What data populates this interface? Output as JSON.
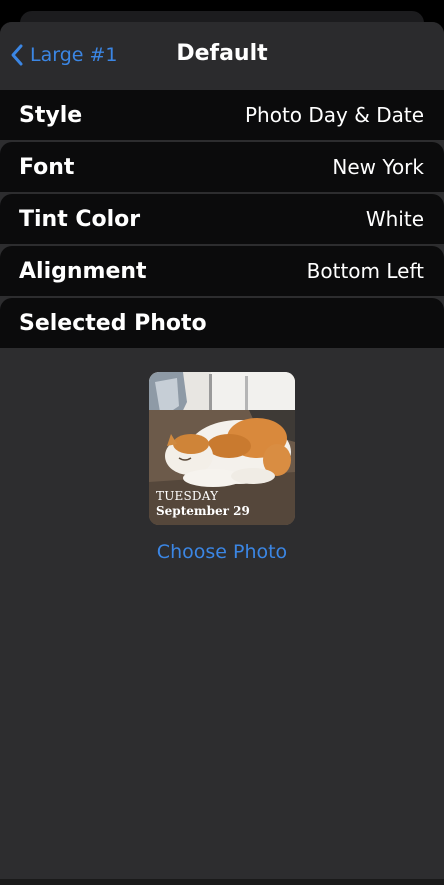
{
  "nav": {
    "back_label": "Large #1",
    "title": "Default"
  },
  "settings": [
    {
      "label": "Style",
      "value": "Photo Day & Date"
    },
    {
      "label": "Font",
      "value": "New York"
    },
    {
      "label": "Tint Color",
      "value": "White"
    },
    {
      "label": "Alignment",
      "value": "Bottom Left"
    },
    {
      "label": "Selected Photo",
      "value": ""
    }
  ],
  "photo": {
    "day": "TUESDAY",
    "date": "September 29",
    "choose_label": "Choose Photo"
  },
  "colors": {
    "accent": "#3b86e4",
    "sheet_background": "#2d2d2f",
    "row_background": "#0b0b0c"
  },
  "icons": {
    "back": "chevron-left-icon"
  }
}
